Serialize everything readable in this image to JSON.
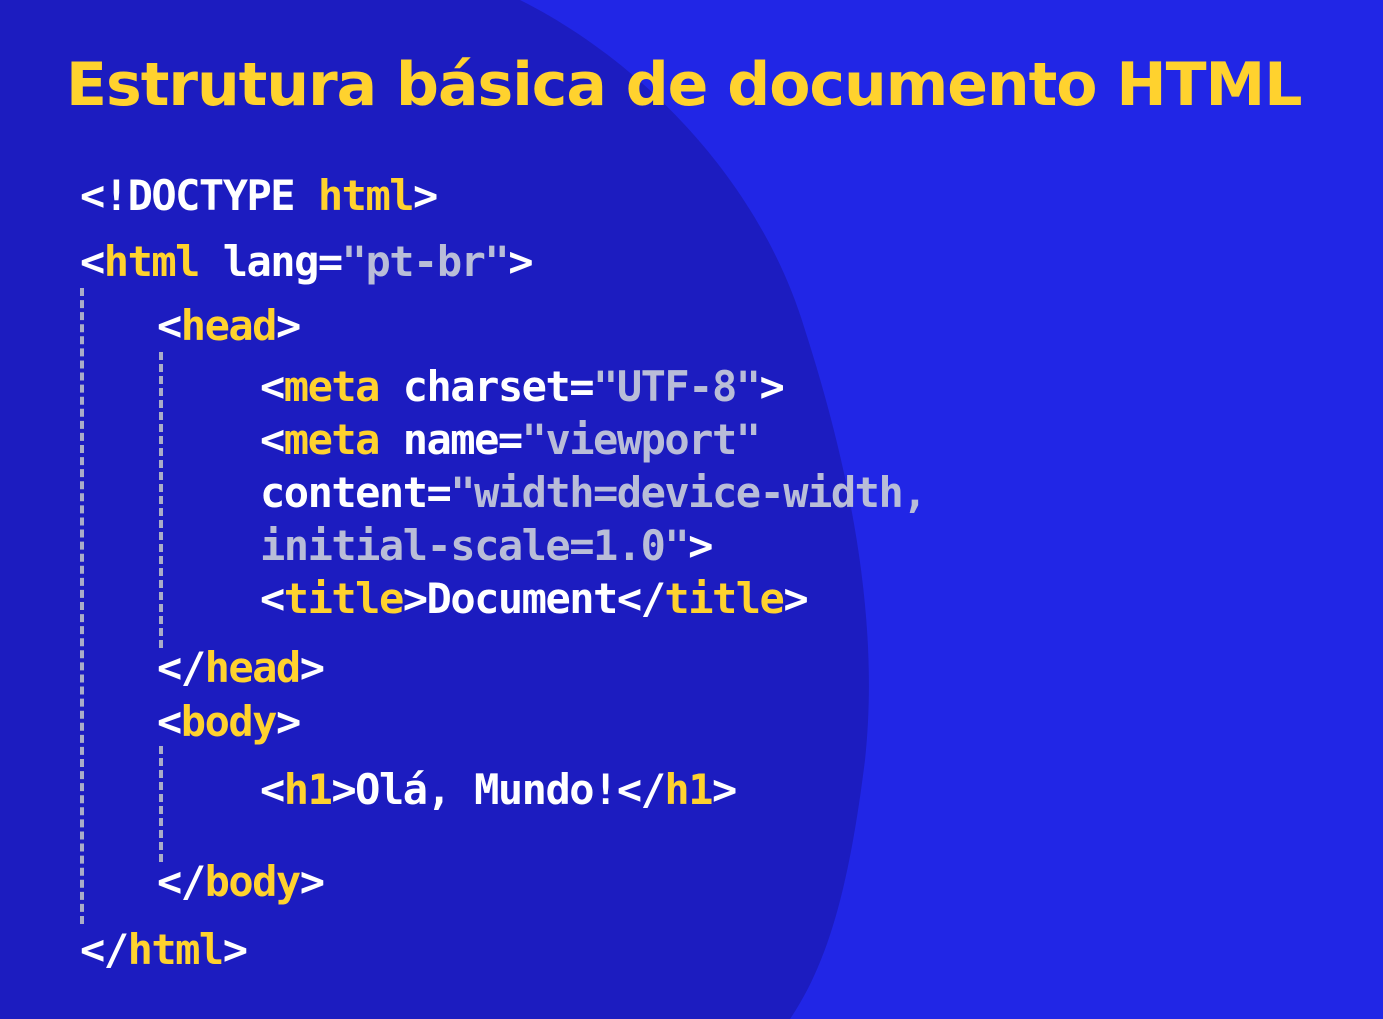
{
  "slide": {
    "title": "Estrutura básica de documento HTML",
    "colors": {
      "background": "#2126e6",
      "blob": "#1c1cc0",
      "title": "#ffd22e",
      "tag": "#ffd22e",
      "text": "#ffffff",
      "string": "#b9bdd8",
      "guide": "#a9acc8"
    }
  },
  "code": {
    "doctype": {
      "open": "<!DOCTYPE ",
      "keyword": "html",
      "close": ">"
    },
    "html_open": {
      "lt": "<",
      "tag": "html",
      "attr": " lang=",
      "value": "\"pt-br\"",
      "gt": ">"
    },
    "head_open": {
      "lt": "<",
      "tag": "head",
      "gt": ">"
    },
    "meta_charset": {
      "lt": "<",
      "tag": "meta",
      "attr": " charset=",
      "value": "\"UTF-8\"",
      "gt": ">"
    },
    "meta_viewport": {
      "lt": "<",
      "tag": "meta",
      "attr": " name=",
      "value": "\"viewport\"",
      "attr2": "content=",
      "value2_line1": "\"width=device-width,",
      "value2_line2": "initial-scale=1.0\"",
      "gt": ">"
    },
    "title": {
      "lt": "<",
      "tag": "title",
      "gt": ">",
      "text": "Document",
      "close_lt": "</",
      "close_tag": "title",
      "close_gt": ">"
    },
    "head_close": {
      "lt": "</",
      "tag": "head",
      "gt": ">"
    },
    "body_open": {
      "lt": "<",
      "tag": "body",
      "gt": ">"
    },
    "h1": {
      "lt": "<",
      "tag": "h1",
      "gt": ">",
      "text": "Olá, Mundo!",
      "close_lt": "</",
      "close_tag": "h1",
      "close_gt": ">"
    },
    "body_close": {
      "lt": "</",
      "tag": "body",
      "gt": ">"
    },
    "html_close": {
      "lt": "</",
      "tag": "html",
      "gt": ">"
    }
  }
}
